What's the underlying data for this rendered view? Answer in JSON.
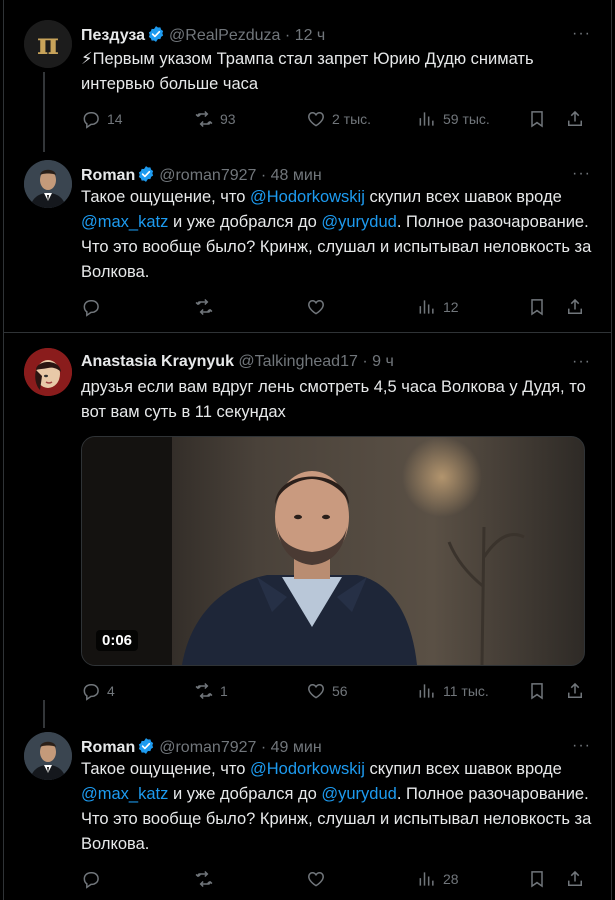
{
  "tweets": [
    {
      "name": "Пездуза",
      "handle": "@RealPezduza",
      "time": "12 ч",
      "text_pre": "⚡Первым указом Трампа стал запрет Юрию Дудю снимать интервью больше часа",
      "replies": "14",
      "retweets": "93",
      "likes": "2 тыс.",
      "views": "59 тыс."
    },
    {
      "name": "Roman",
      "handle": "@roman7927",
      "time": "48 мин",
      "t1": "Такое ощущение, что ",
      "m1": "@Hodorkowskij",
      "t2": " скупил всех шавок вроде ",
      "m2": "@max_katz",
      "t3": " и уже добрался до ",
      "m3": "@yurydud",
      "t4": ". Полное разочарование. Что это вообще было? Кринж, слушал и испытывал неловкость за Волкова.",
      "replies": "",
      "retweets": "",
      "likes": "",
      "views": "12"
    },
    {
      "name": "Anastasia Kraynyuk",
      "handle": "@Talkinghead17",
      "time": "9 ч",
      "text": "друзья если вам вдруг лень смотреть 4,5 часа Волкова у Дудя, то вот вам суть в 11 секундах",
      "duration": "0:06",
      "replies": "4",
      "retweets": "1",
      "likes": "56",
      "views": "11 тыс."
    },
    {
      "name": "Roman",
      "handle": "@roman7927",
      "time": "49 мин",
      "t1": "Такое ощущение, что ",
      "m1": "@Hodorkowskij",
      "t2": " скупил всех шавок вроде ",
      "m2": "@max_katz",
      "t3": " и уже добрался до ",
      "m3": "@yurydud",
      "t4": ". Полное разочарование. Что это вообще было? Кринж, слушал и испытывал неловкость за Волкова.",
      "replies": "",
      "retweets": "",
      "likes": "",
      "views": "28"
    }
  ],
  "common": {
    "dot": "·",
    "more": "···"
  },
  "colors": {
    "background": "#000000",
    "text": "#e7e9ea",
    "muted": "#71767b",
    "accent": "#1d9bf0",
    "border": "#2f3336"
  }
}
